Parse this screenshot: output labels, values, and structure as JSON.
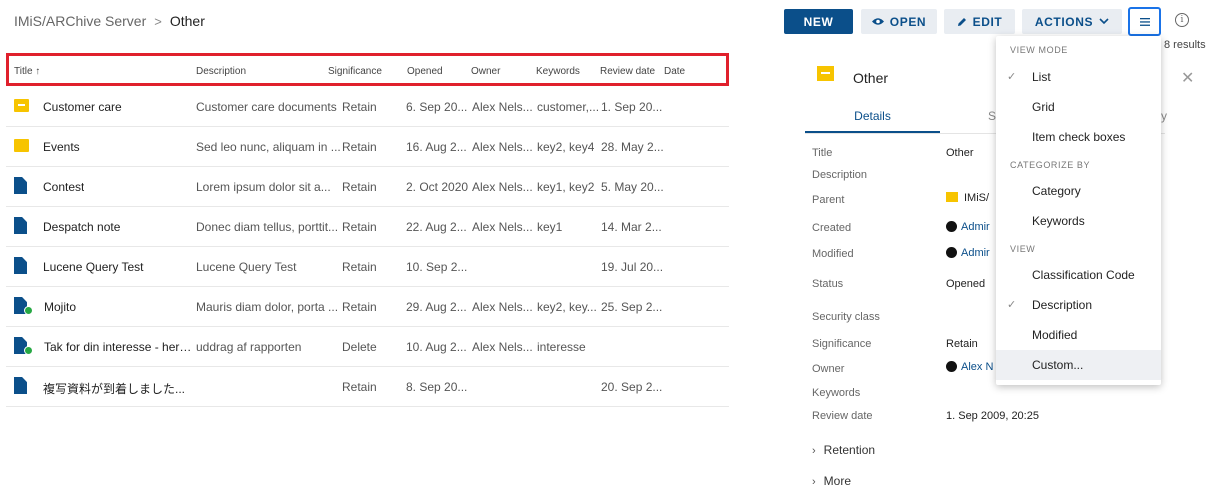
{
  "breadcrumb": {
    "root": "IMiS/ARChive Server",
    "separator": ">",
    "current": "Other"
  },
  "toolbar": {
    "new_label": "NEW",
    "open_label": "OPEN",
    "edit_label": "EDIT",
    "actions_label": "ACTIONS",
    "open_icon": "eye-icon",
    "edit_icon": "pencil-icon",
    "actions_icon": "chevron-down-icon",
    "viewmode_icon": "list-icon",
    "info_icon": "info-icon",
    "results": "8 results"
  },
  "table": {
    "columns": [
      "Title ↑",
      "Description",
      "Significance",
      "Opened",
      "Owner",
      "Keywords",
      "Review date",
      "Date"
    ],
    "rows": [
      {
        "icon": "box-folder-icon",
        "badge": false,
        "title": "Customer care",
        "description": "Customer care documents",
        "significance": "Retain",
        "opened": "6. Sep 20...",
        "owner": "Alex Nels...",
        "keywords": "customer,...",
        "review": "1. Sep 20..."
      },
      {
        "icon": "folder-icon",
        "badge": false,
        "title": "Events",
        "description": "Sed leo nunc, aliquam in ...",
        "significance": "Retain",
        "opened": "16. Aug 2...",
        "owner": "Alex Nels...",
        "keywords": "key2, key4",
        "review": "28. May 2..."
      },
      {
        "icon": "document-icon",
        "badge": false,
        "title": "Contest",
        "description": "Lorem ipsum dolor sit a...",
        "significance": "Retain",
        "opened": "2. Oct 2020",
        "owner": "Alex Nels...",
        "keywords": "key1, key2",
        "review": "5. May 20..."
      },
      {
        "icon": "document-icon",
        "badge": false,
        "title": "Despatch note",
        "description": "Donec diam tellus, porttit...",
        "significance": "Retain",
        "opened": "22. Aug 2...",
        "owner": "Alex Nels...",
        "keywords": "key1",
        "review": "14. Mar 2..."
      },
      {
        "icon": "document-icon",
        "badge": false,
        "title": "Lucene Query Test",
        "description": "Lucene Query Test",
        "significance": "Retain",
        "opened": "10. Sep 2...",
        "owner": "",
        "keywords": "",
        "review": "19. Jul 20..."
      },
      {
        "icon": "document-icon",
        "badge": true,
        "title": "Mojito",
        "description": "Mauris diam dolor, porta ...",
        "significance": "Retain",
        "opened": "29. Aug 2...",
        "owner": "Alex Nels...",
        "keywords": "key2, key...",
        "review": "25. Sep 2..."
      },
      {
        "icon": "document-icon",
        "badge": true,
        "title": "Tak for din interesse - her ...",
        "description": "uddrag af rapporten",
        "significance": "Delete",
        "opened": "10. Aug 2...",
        "owner": "Alex Nels...",
        "keywords": "interesse",
        "review": ""
      },
      {
        "icon": "document-icon",
        "badge": false,
        "title": "複写資料が到着しました...",
        "description": "",
        "significance": "Retain",
        "opened": "8. Sep 20...",
        "owner": "",
        "keywords": "",
        "review": "20. Sep 2..."
      }
    ]
  },
  "detail": {
    "title": "Other",
    "tabs": {
      "details": "Details",
      "s": "S",
      "y": "y"
    },
    "props": {
      "title_label": "Title",
      "title_value": "Other",
      "description_label": "Description",
      "parent_label": "Parent",
      "parent_value": "IMiS/",
      "created_label": "Created",
      "created_value": "Admir",
      "modified_label": "Modified",
      "modified_value": "Admir",
      "status_label": "Status",
      "status_value": "Opened",
      "security_label": "Security class",
      "significance_label": "Significance",
      "significance_value": "Retain",
      "owner_label": "Owner",
      "owner_value": "Alex N",
      "keywords_label": "Keywords",
      "review_label": "Review date",
      "review_value": "1. Sep 2009, 20:25"
    },
    "expanders": {
      "retention": "Retention",
      "more": "More"
    }
  },
  "menu": {
    "section_viewmode": "VIEW MODE",
    "list": "List",
    "grid": "Grid",
    "item_check_boxes": "Item check boxes",
    "section_categorize": "CATEGORIZE BY",
    "category": "Category",
    "keywords": "Keywords",
    "section_view": "VIEW",
    "classification_code": "Classification Code",
    "description": "Description",
    "modified": "Modified",
    "custom": "Custom...",
    "check_glyph": "✓"
  },
  "colors": {
    "primary": "#0b4f8a",
    "folder": "#f7c400",
    "highlight": "#e0202c",
    "badge": "#27a844"
  }
}
